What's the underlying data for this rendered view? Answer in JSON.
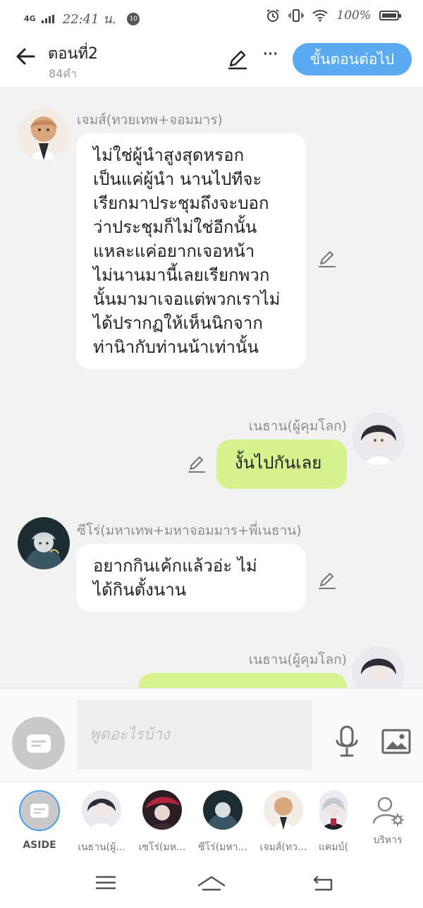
{
  "status_bar": {
    "network": "4G",
    "time": "22:41 น.",
    "badge": "10",
    "battery": "100%"
  },
  "header": {
    "title": "ตอนที่2",
    "word_count": "84คำ",
    "more_label": "···",
    "next_label": "ขั้นตอนต่อไป"
  },
  "messages": [
    {
      "sender": "เจมส์(ทวยเทพ+จอมมาร)",
      "lines": [
        "ไม่ใช่ผู้นำสูงสุดหรอก",
        "เป็นแค่ผู้นำ นานไปทีจะ",
        "เรียกมาประชุมถึงจะบอก",
        "ว่าประชุมก็ไม่ใช่อีกนั้น",
        "แหละแค่อยากเจอหน้า",
        "ไม่นานมานี้เลยเรียกพวก",
        "นั้นมามาเจอแต่พวกเราไม่",
        "ได้ปรากฏให้เห็นนิกจาก",
        "ท่านิากับท่านน้าเท่านั้น"
      ]
    },
    {
      "sender": "เนธาน(ผู้คุมโลก)",
      "lines": [
        "งั้นไปกันเลย"
      ]
    },
    {
      "sender": "ซีโร่(มหาเทพ+มหาจอมมาร+พี่เนธาน)",
      "lines": [
        "อยากกินเค้กแล้วอ่ะ ไม่",
        "ได้กินตั้งนาน"
      ]
    },
    {
      "sender": "เนธาน(ผู้คุมโลก)",
      "lines": [
        ""
      ]
    }
  ],
  "composer": {
    "placeholder": "พูดอะไรบ้าง"
  },
  "characters": [
    {
      "label": "ASIDE"
    },
    {
      "label": "เนธาน(ผู้..."
    },
    {
      "label": "เซโร่(มห..."
    },
    {
      "label": "ซีโร่(มหา..."
    },
    {
      "label": "เจมส์(ทว..."
    },
    {
      "label": "แคมบ์("
    },
    {
      "label": "บริหาร"
    }
  ],
  "colors": {
    "accent": "#5aaaf2",
    "bubble_right": "#d6f38e",
    "chat_bg": "#f2f2f2"
  }
}
